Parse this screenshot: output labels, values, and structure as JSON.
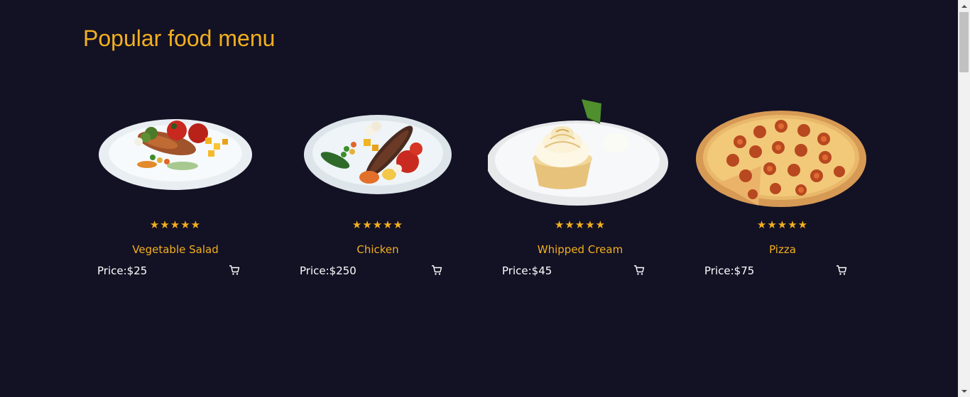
{
  "page": {
    "title": "Popular food menu"
  },
  "colors": {
    "background": "#131124",
    "accent": "#f2b01e",
    "text": "#ffffff"
  },
  "menu": [
    {
      "name": "Vegetable Salad",
      "price": "Price:$25",
      "stars": "★★★★★",
      "rating": 5,
      "image": "plate-salad-image",
      "cart_icon": "cart-icon"
    },
    {
      "name": "Chicken",
      "price": "Price:$250",
      "stars": "★★★★★",
      "rating": 5,
      "image": "plate-chicken-image",
      "cart_icon": "cart-icon"
    },
    {
      "name": "Whipped Cream",
      "price": "Price:$45",
      "stars": "★★★★★",
      "rating": 5,
      "image": "plate-dessert-image",
      "cart_icon": "cart-icon"
    },
    {
      "name": "Pizza",
      "price": "Price:$75",
      "stars": "★★★★★",
      "rating": 5,
      "image": "pizza-image",
      "cart_icon": "cart-icon"
    }
  ]
}
